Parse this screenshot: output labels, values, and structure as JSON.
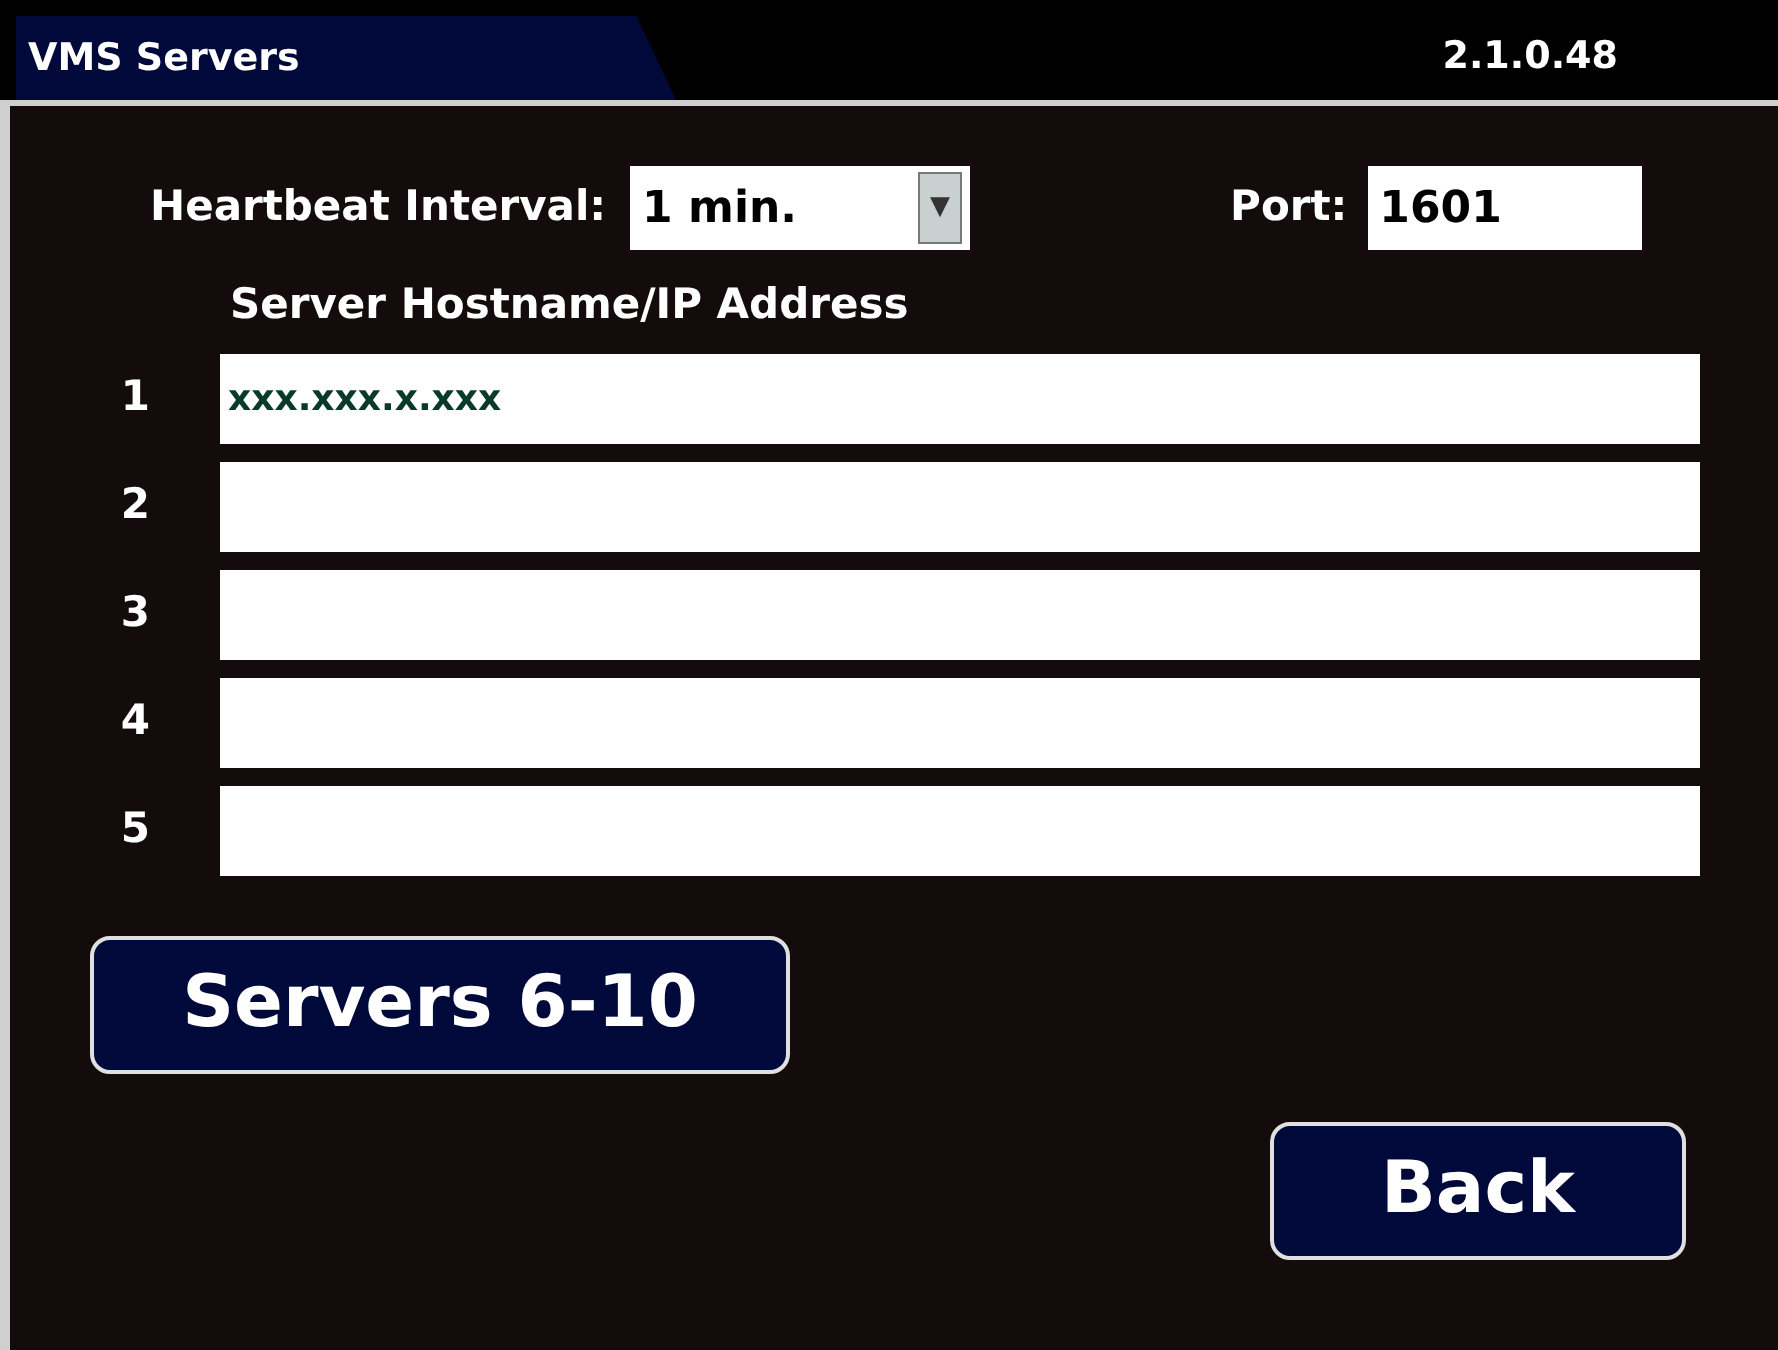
{
  "tab": {
    "title": "VMS Servers"
  },
  "version": "2.1.0.48",
  "heartbeat": {
    "label": "Heartbeat Interval:",
    "value": "1 min.",
    "arrow": "▼"
  },
  "port": {
    "label": "Port:",
    "value": "1601"
  },
  "servers_heading": "Server Hostname/IP Address",
  "servers": [
    {
      "number": "1",
      "value": "xxx.xxx.x.xxx"
    },
    {
      "number": "2"
    },
    {
      "number": "3"
    },
    {
      "number": "4"
    },
    {
      "number": "5"
    }
  ],
  "buttons": [
    {
      "label": "Servers 6-10",
      "kind": "page"
    },
    {
      "label": "Back",
      "kind": "back"
    }
  ]
}
